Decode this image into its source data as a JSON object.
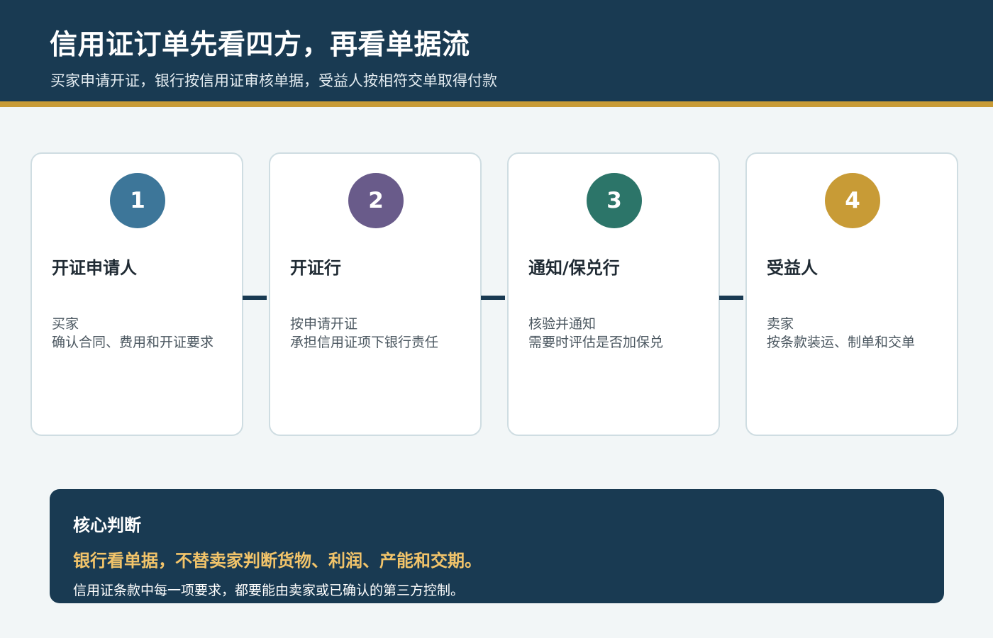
{
  "header": {
    "title": "信用证订单先看四方，再看单据流",
    "subtitle": "买家申请开证，银行按信用证审核单据，受益人按相符交单取得付款"
  },
  "colors": {
    "header_bg": "#193a52",
    "accent_gold": "#c89b36",
    "highlight": "#f2c46a"
  },
  "parties": [
    {
      "number": "1",
      "color": "#3d7699",
      "title": "开证申请人",
      "lines": [
        "买家",
        "确认合同、费用和开证要求"
      ]
    },
    {
      "number": "2",
      "color": "#695b8a",
      "title": "开证行",
      "lines": [
        "按申请开证",
        "承担信用证项下银行责任"
      ]
    },
    {
      "number": "3",
      "color": "#2c7569",
      "title": "通知/保兑行",
      "lines": [
        "核验并通知",
        "需要时评估是否加保兑"
      ]
    },
    {
      "number": "4",
      "color": "#c89b36",
      "title": "受益人",
      "lines": [
        "卖家",
        "按条款装运、制单和交单"
      ]
    }
  ],
  "judgment": {
    "label": "核心判断",
    "main": "银行看单据，不替卖家判断货物、利润、产能和交期。",
    "note": "信用证条款中每一项要求，都要能由卖家或已确认的第三方控制。"
  }
}
